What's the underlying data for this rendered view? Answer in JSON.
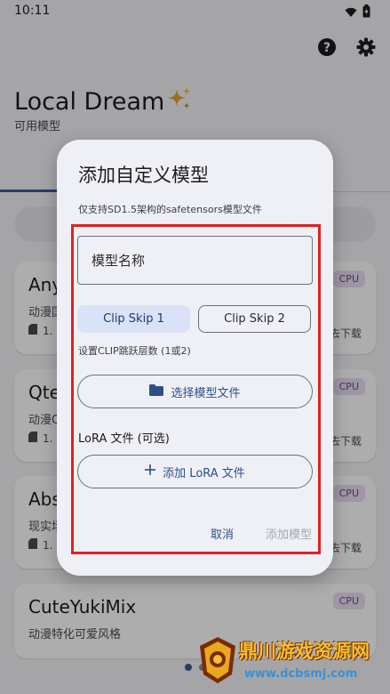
{
  "status_bar": {
    "time": "10:11"
  },
  "app": {
    "title": "Local Dream",
    "subtitle": "可用模型"
  },
  "models": [
    {
      "name": "Any",
      "desc": "动漫国",
      "size": "1.",
      "badge": "CPU",
      "download": "去下载"
    },
    {
      "name": "Qte",
      "desc": "动漫Q",
      "size": "1.",
      "badge": "CPU",
      "download": "去下载"
    },
    {
      "name": "Abs",
      "desc": "现实场",
      "size": "1.",
      "badge": "CPU",
      "download": "去下载"
    },
    {
      "name": "CuteYukiMix",
      "desc": "动漫特化可爱风格",
      "badge": "CPU"
    }
  ],
  "dialog": {
    "title": "添加自定义模型",
    "subtitle": "仅支持SD1.5架构的safetensors模型文件",
    "name_placeholder": "模型名称",
    "clip_skip_1": "Clip Skip 1",
    "clip_skip_2": "Clip Skip 2",
    "clip_help": "设置CLIP跳跃层数 (1或2)",
    "select_file_label": "选择模型文件",
    "lora_label": "LoRA 文件 (可选)",
    "add_lora_label": "添加 LoRA 文件",
    "cancel_label": "取消",
    "confirm_label": "添加模型"
  },
  "watermark": {
    "title": "鼎川游戏资源网",
    "url": "www.dcbsmj.com"
  },
  "colors": {
    "accent": "#3b5a96",
    "highlight": "#e02020",
    "badge_bg": "#e9ddf2"
  },
  "icons": [
    "wifi-icon",
    "battery-icon",
    "help-icon",
    "settings-icon",
    "sparkle-icon",
    "folder-icon",
    "plus-icon",
    "sd-card-icon"
  ]
}
